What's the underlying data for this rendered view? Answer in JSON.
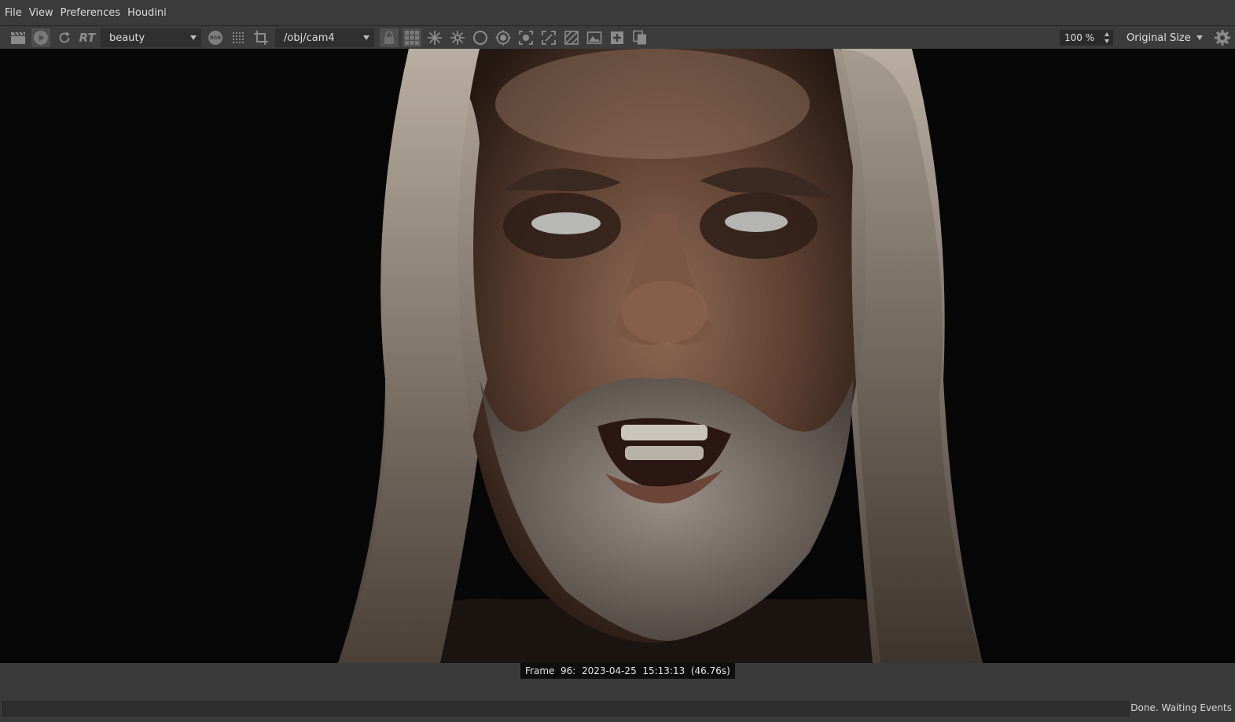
{
  "menubar": {
    "items": [
      "File",
      "View",
      "Preferences",
      "Houdini"
    ]
  },
  "toolbar": {
    "aov_value": "beauty",
    "camera_value": "/obj/cam4",
    "rgb_badge": "RGB",
    "rt_label": "RT",
    "zoom_value": "100 %",
    "size_value": "Original Size"
  },
  "render": {
    "frame_info": "Frame  96:  2023-04-25  15:13:13  (46.76s)"
  },
  "status": {
    "text": "Done. Waiting Events"
  }
}
